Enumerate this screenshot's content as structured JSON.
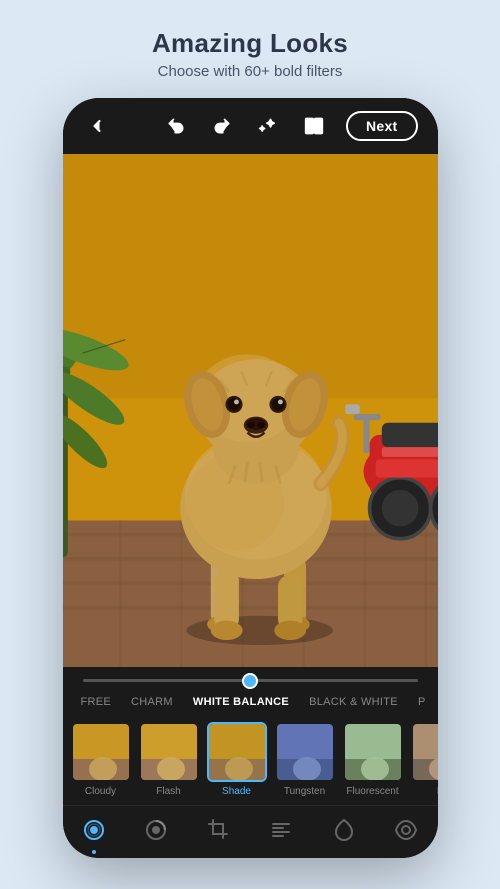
{
  "header": {
    "title": "Amazing Looks",
    "subtitle": "Choose with 60+ bold filters"
  },
  "toolbar": {
    "next_label": "Next",
    "icons": {
      "back": "←",
      "undo": "↩",
      "redo": "↪",
      "magic": "✦",
      "compare": "⧉"
    }
  },
  "slider": {
    "value": 50
  },
  "filter_tabs": [
    {
      "id": "free",
      "label": "FREE",
      "active": false
    },
    {
      "id": "charm",
      "label": "CHARM",
      "active": false
    },
    {
      "id": "white_balance",
      "label": "WHITE BALANCE",
      "active": true
    },
    {
      "id": "black_white",
      "label": "BLACK & WHITE",
      "active": false
    },
    {
      "id": "p",
      "label": "P",
      "active": false
    }
  ],
  "filter_items": [
    {
      "id": "cloudy",
      "label": "Cloudy",
      "active": false,
      "tint": "rgba(200,180,140,0.3)"
    },
    {
      "id": "flash",
      "label": "Flash",
      "active": false,
      "tint": "rgba(220,200,160,0.2)"
    },
    {
      "id": "shade",
      "label": "Shade",
      "active": true,
      "tint": "rgba(180,160,100,0.4)"
    },
    {
      "id": "tungsten",
      "label": "Tungsten",
      "active": false,
      "tint": "rgba(100,130,200,0.35)"
    },
    {
      "id": "fluorescent",
      "label": "Fluorescent",
      "active": false,
      "tint": "rgba(150,200,150,0.3)"
    },
    {
      "id": "d",
      "label": "D",
      "active": false,
      "tint": "rgba(160,140,120,0.3)"
    }
  ],
  "bottom_nav": [
    {
      "id": "filters",
      "icon": "filters",
      "active": true
    },
    {
      "id": "adjust",
      "icon": "adjust",
      "active": false
    },
    {
      "id": "crop",
      "icon": "crop",
      "active": false
    },
    {
      "id": "tools",
      "icon": "tools",
      "active": false
    },
    {
      "id": "healing",
      "icon": "healing",
      "active": false
    },
    {
      "id": "view",
      "icon": "view",
      "active": false
    }
  ],
  "colors": {
    "accent": "#4db8ff",
    "bg_light": "#dce9f5",
    "phone_bg": "#1a1a1a",
    "active_tab": "#ffffff",
    "inactive_tab": "#888888"
  }
}
